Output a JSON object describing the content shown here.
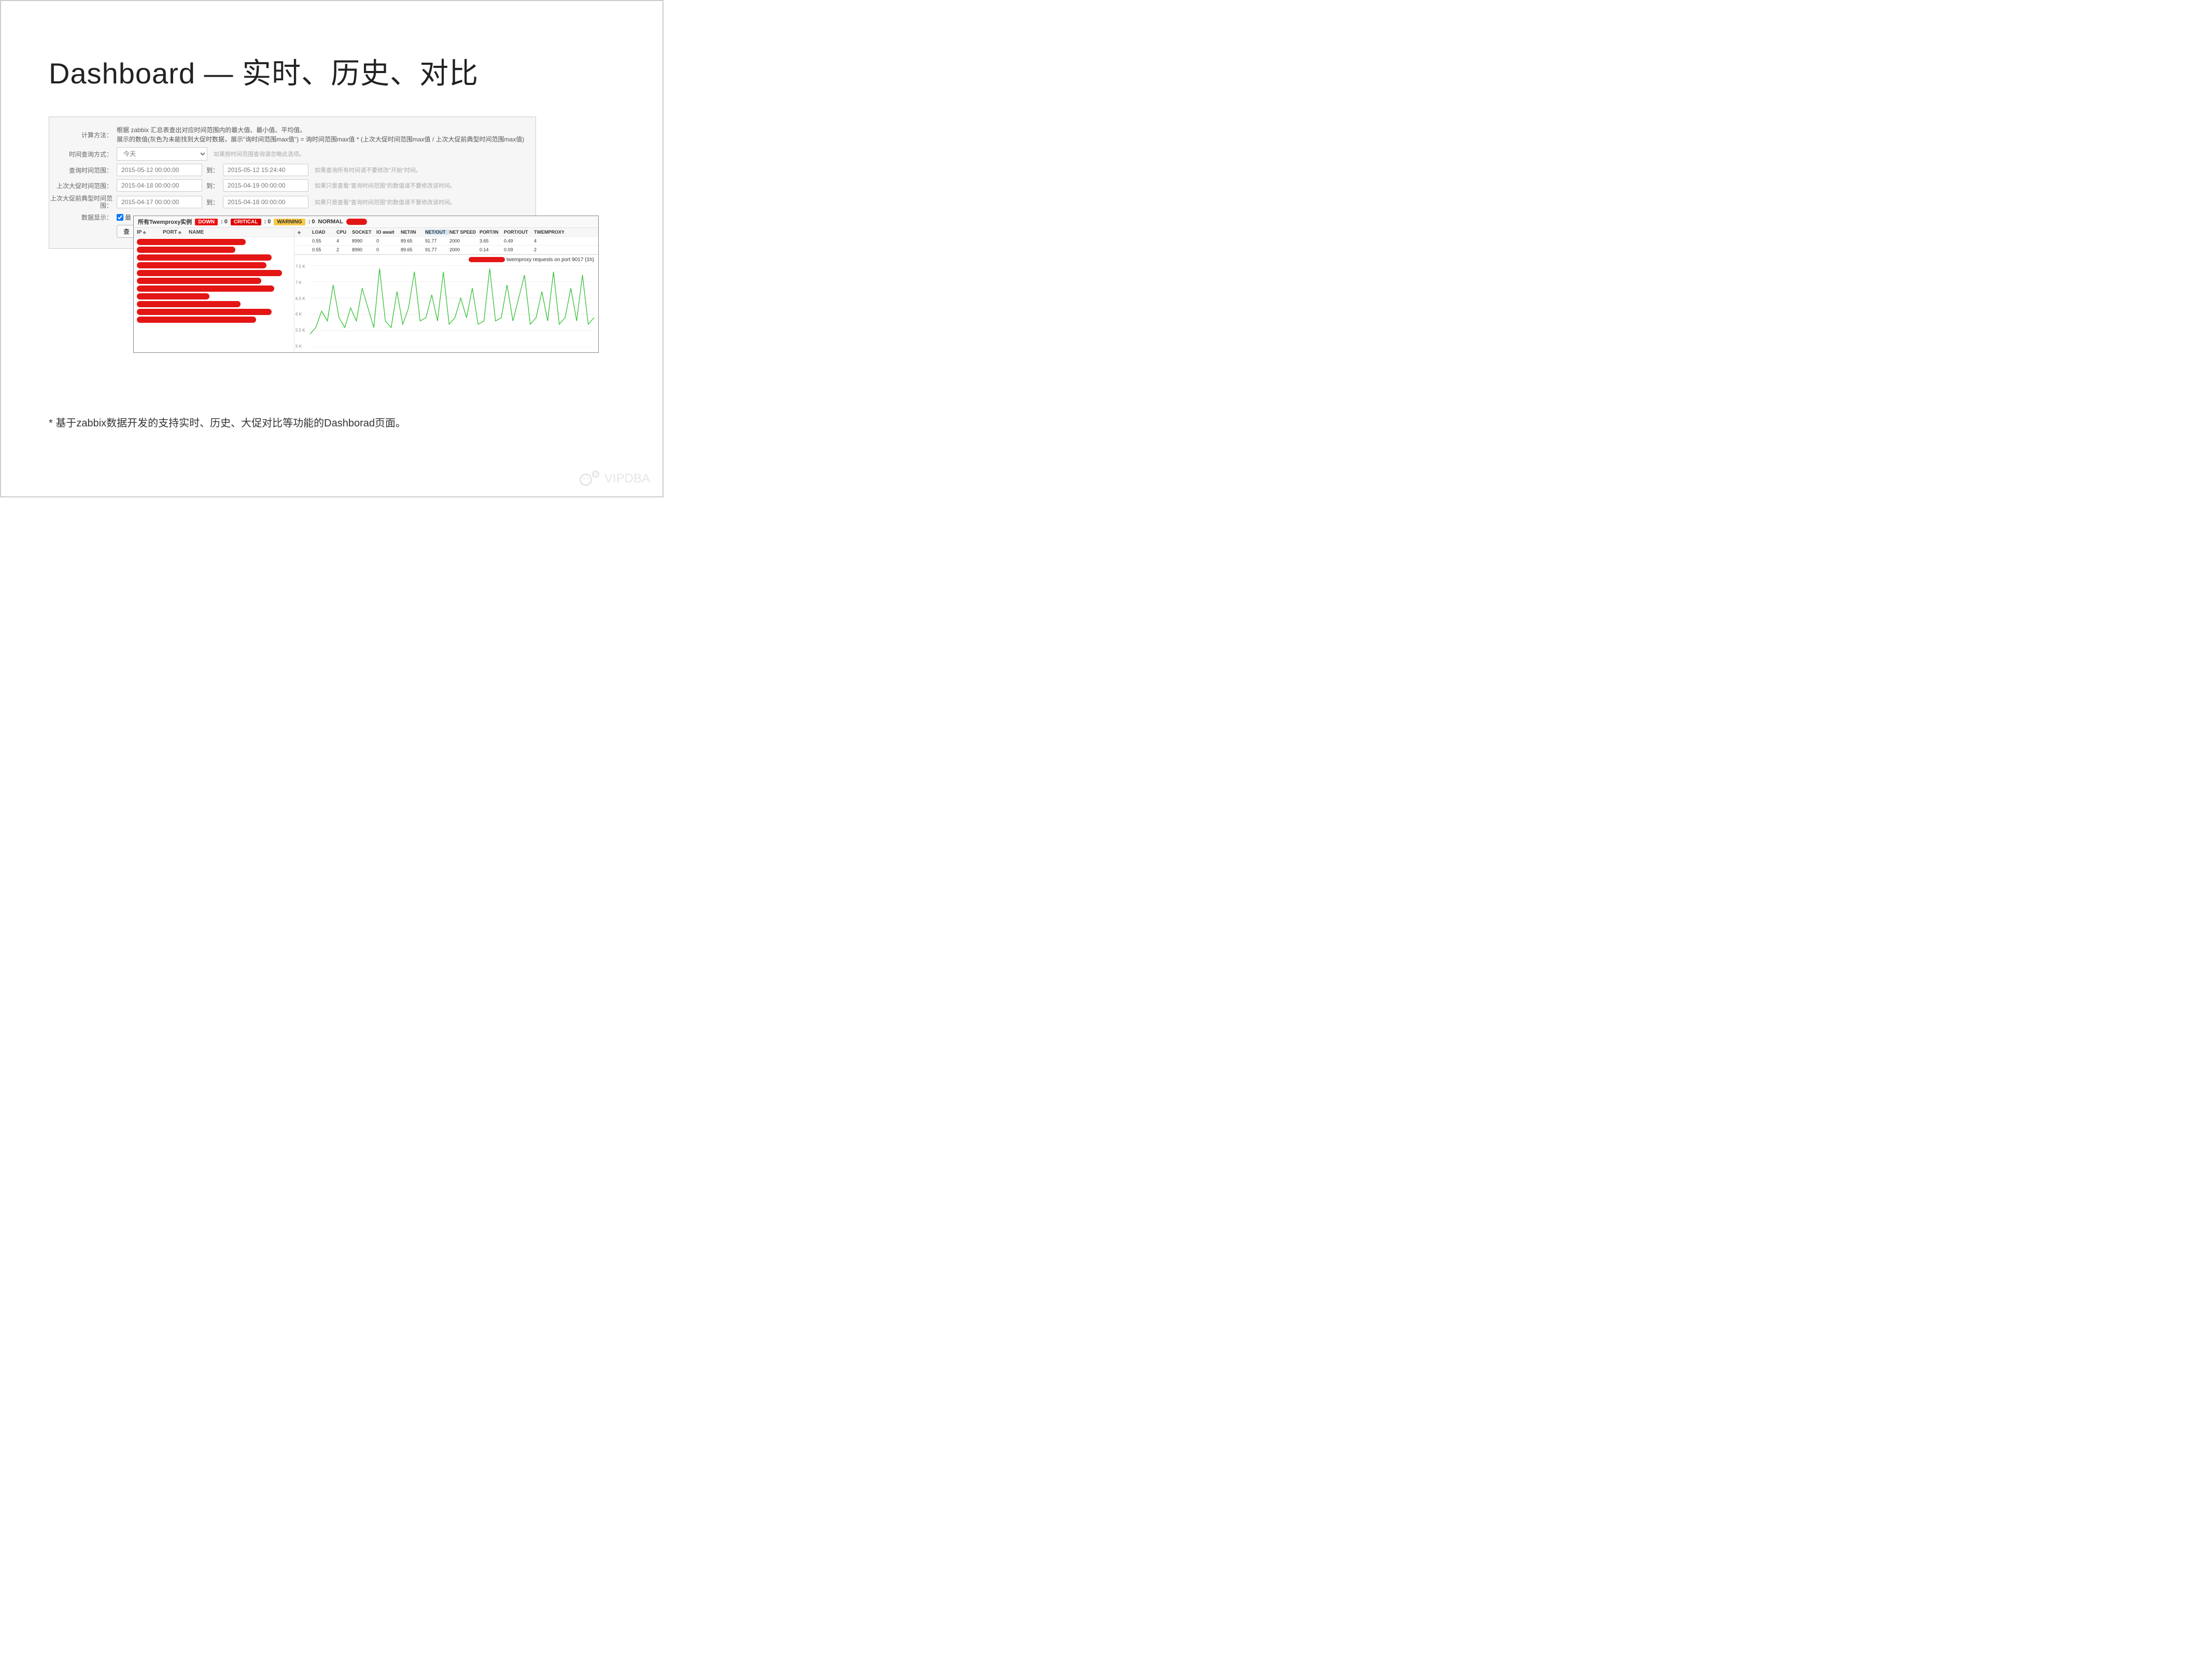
{
  "title": "Dashboard — 实时、历史、对比",
  "form": {
    "calc_label": "计算方法：",
    "calc_text": "根据 zabbix 汇总表查出对应时间范围内的最大值、最小值、平均值。\n展示的数值(灰色为未能找到大促时数据，展示\"询时间范围max值\") = 询时间范围max值 * (上次大促时间范围max值 / 上次大促前典型时间范围max值)",
    "time_query_label": "时间查询方式：",
    "time_query_value": "今天",
    "time_query_hint": "如果按时间范围查询请忽略此选项。",
    "range_label": "查询时间范围：",
    "range_from": "2015-05-12 00:00:00",
    "range_to_label": "到：",
    "range_to": "2015-05-12 15:24:40",
    "range_hint": "如果查询所有时间请不要修改\"开始\"时间。",
    "promo_label": "上次大促时间范围：",
    "promo_from": "2015-04-18 00:00:00",
    "promo_to": "2015-04-19 00:00:00",
    "promo_hint": "如果只是查看\"查询时间范围\"的数值请不要修改该时间。",
    "typical_label": "上次大促前典型时间范围：",
    "typical_from": "2015-04-17 00:00:00",
    "typical_to": "2015-04-18 00:00:00",
    "typical_hint": "如果只是查看\"查询时间范围\"的数值请不要修改该时间。",
    "display_label": "数据显示：",
    "display_checkbox": "最",
    "query_btn": "查"
  },
  "status": {
    "title": "所有Twemproxy实例",
    "down_label": "DOWN",
    "down_count": ": 0",
    "critical_label": "CRITICAL",
    "critical_count": ": 0",
    "warning_label": "WARNING",
    "warning_count": ": 0",
    "normal_label": "NORMAL"
  },
  "table": {
    "left_headers": {
      "ip": "IP",
      "port": "PORT",
      "name": "NAME"
    },
    "right_headers": [
      "LOAD",
      "CPU",
      "SOCKET",
      "IO await",
      "NET/IN",
      "NET/OUT",
      "NET SPEED",
      "PORT/IN",
      "PORT/OUT",
      "TWEMPROXY"
    ],
    "rows": [
      {
        "load": "0.55",
        "cpu": "4",
        "socket": "8990",
        "io": "0",
        "netin": "89.65",
        "netout": "91.77",
        "speed": "2000",
        "pin": "3.65",
        "pout": "0.49",
        "twem": "4"
      },
      {
        "load": "0.55",
        "cpu": "2",
        "socket": "8990",
        "io": "0",
        "netin": "89.65",
        "netout": "91.77",
        "speed": "2000",
        "pin": "0.14",
        "pout": "0.09",
        "twem": "2"
      }
    ]
  },
  "chart_data": {
    "type": "line",
    "title": "twemproxy requests on port 9017 (1h)",
    "ylabel": "",
    "ylim": [
      5000,
      7500
    ],
    "y_ticks": [
      "7.5 K",
      "7 K",
      "6.5 K",
      "6 K",
      "5.5 K",
      "5 K"
    ],
    "series": [
      {
        "name": "requests",
        "color": "#2bbf2b",
        "values": [
          5400,
          5600,
          6100,
          5800,
          6900,
          5900,
          5600,
          6200,
          5800,
          6800,
          6200,
          5600,
          7400,
          5800,
          5600,
          6700,
          5700,
          6200,
          7300,
          5800,
          5900,
          6600,
          5800,
          7300,
          5700,
          5900,
          6500,
          5900,
          6800,
          5700,
          5800,
          7400,
          5800,
          5900,
          6900,
          5800,
          6500,
          7200,
          5700,
          5900,
          6700,
          5800,
          7300,
          5700,
          5900,
          6800,
          5800,
          7200,
          5700,
          5900
        ]
      }
    ]
  },
  "footer": "*  基于zabbix数据开发的支持实时、历史、大促对比等功能的Dashborad页面。",
  "watermark": "VIPDBA"
}
